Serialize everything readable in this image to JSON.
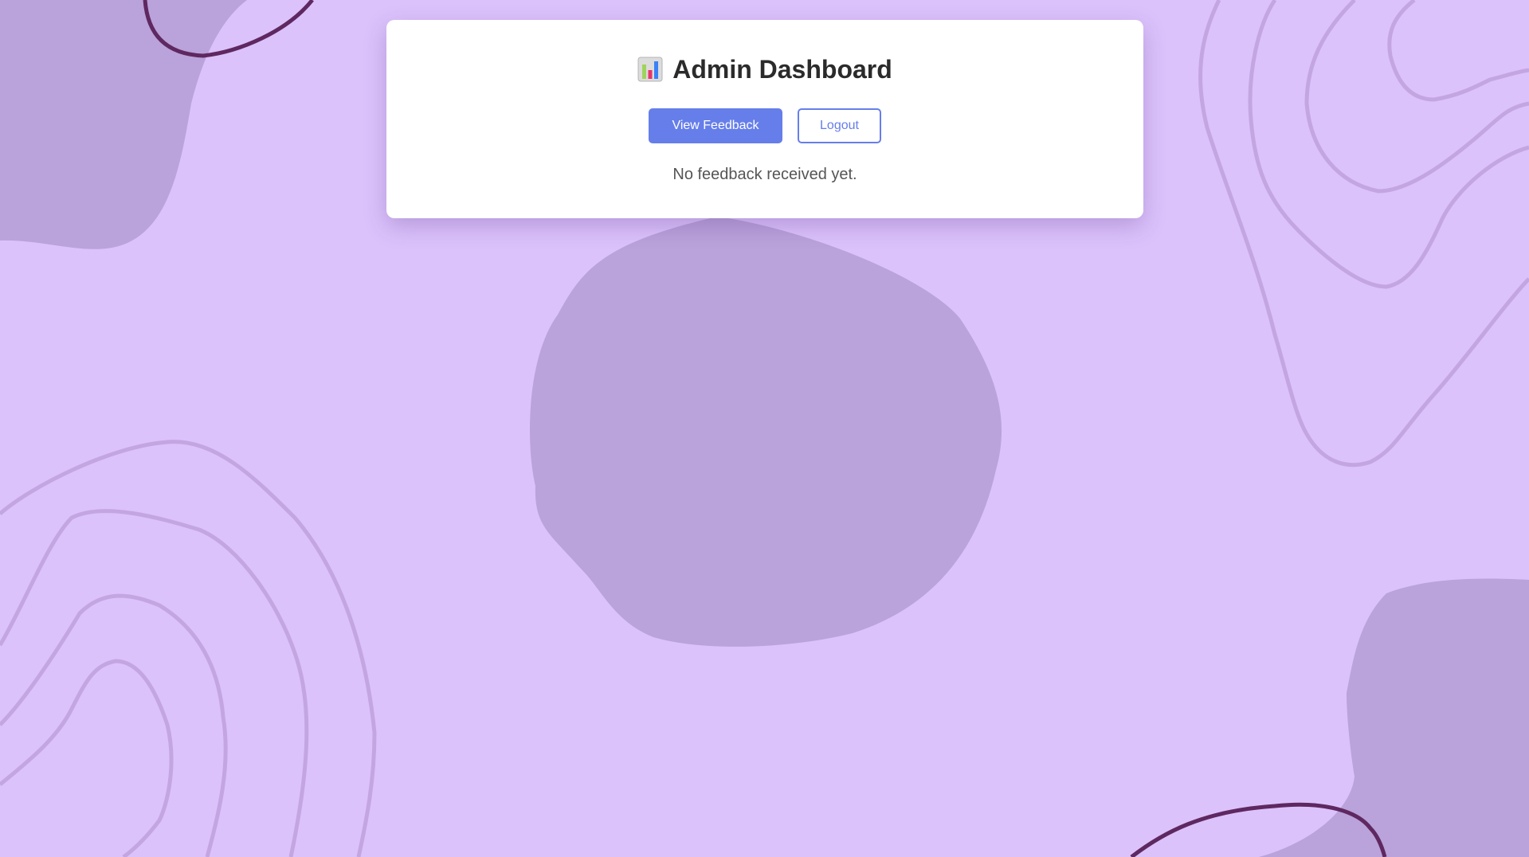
{
  "colors": {
    "background": "#dbc2fb",
    "blob": "#baa2da",
    "contour_light": "#c3a6e1",
    "contour_dark": "#5f2860",
    "primary": "#667eea",
    "card": "#ffffff"
  },
  "header": {
    "icon": "bar-chart-icon",
    "title": "Admin Dashboard"
  },
  "actions": {
    "view_feedback_label": "View Feedback",
    "logout_label": "Logout"
  },
  "main": {
    "empty_message": "No feedback received yet."
  }
}
